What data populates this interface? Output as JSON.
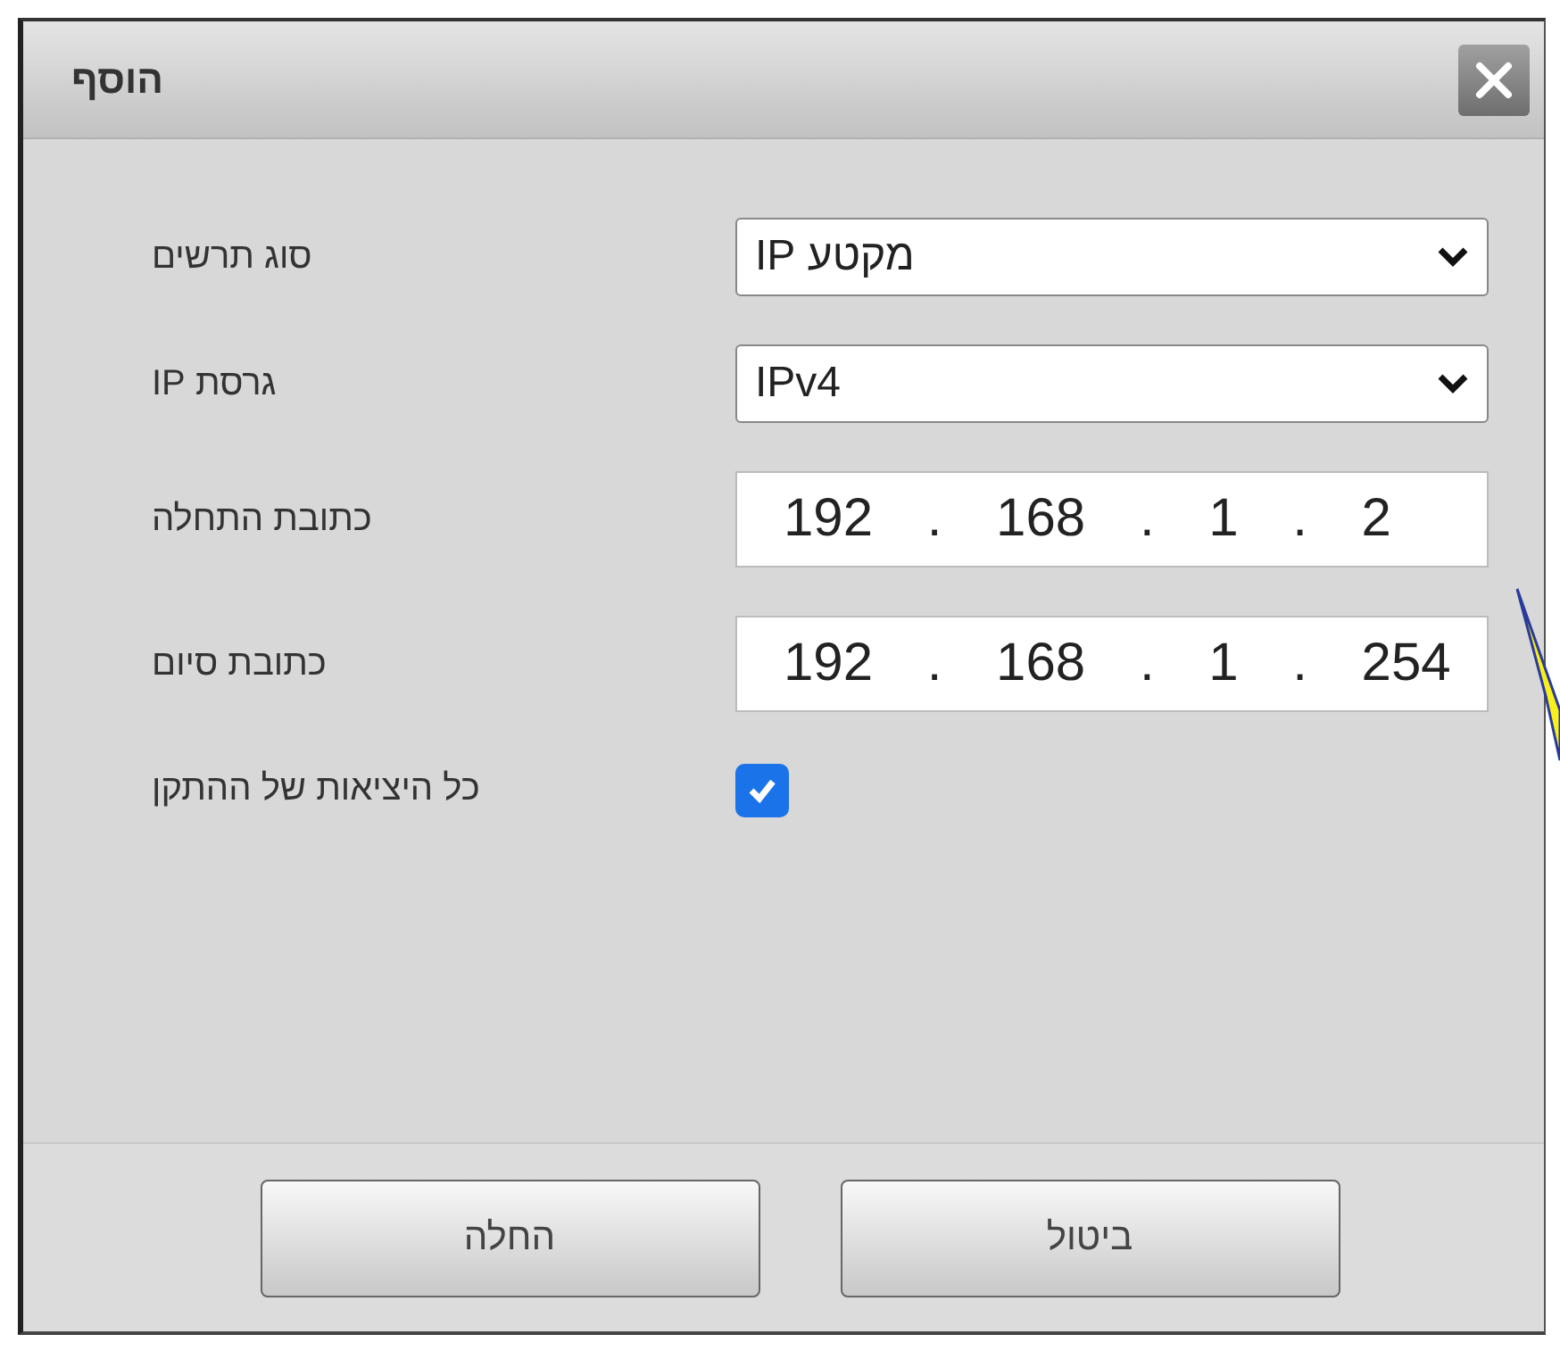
{
  "dialog": {
    "title": "הוסף"
  },
  "fields": [
    {
      "kind": "select",
      "label": "סוג תרשים",
      "value": "מקטע IP"
    },
    {
      "kind": "select",
      "label": "גרסת IP",
      "value": "IPv4"
    },
    {
      "kind": "ip",
      "label": "כתובת התחלה",
      "value": "192 . 168 . 1 . 2"
    },
    {
      "kind": "ip",
      "label": "כתובת סיום",
      "value": "192 . 168 . 1 . 254"
    },
    {
      "kind": "checkbox",
      "label": "כל היציאות של ההתקן",
      "checked": true
    }
  ],
  "buttons": [
    "ביטול",
    "החלה"
  ]
}
